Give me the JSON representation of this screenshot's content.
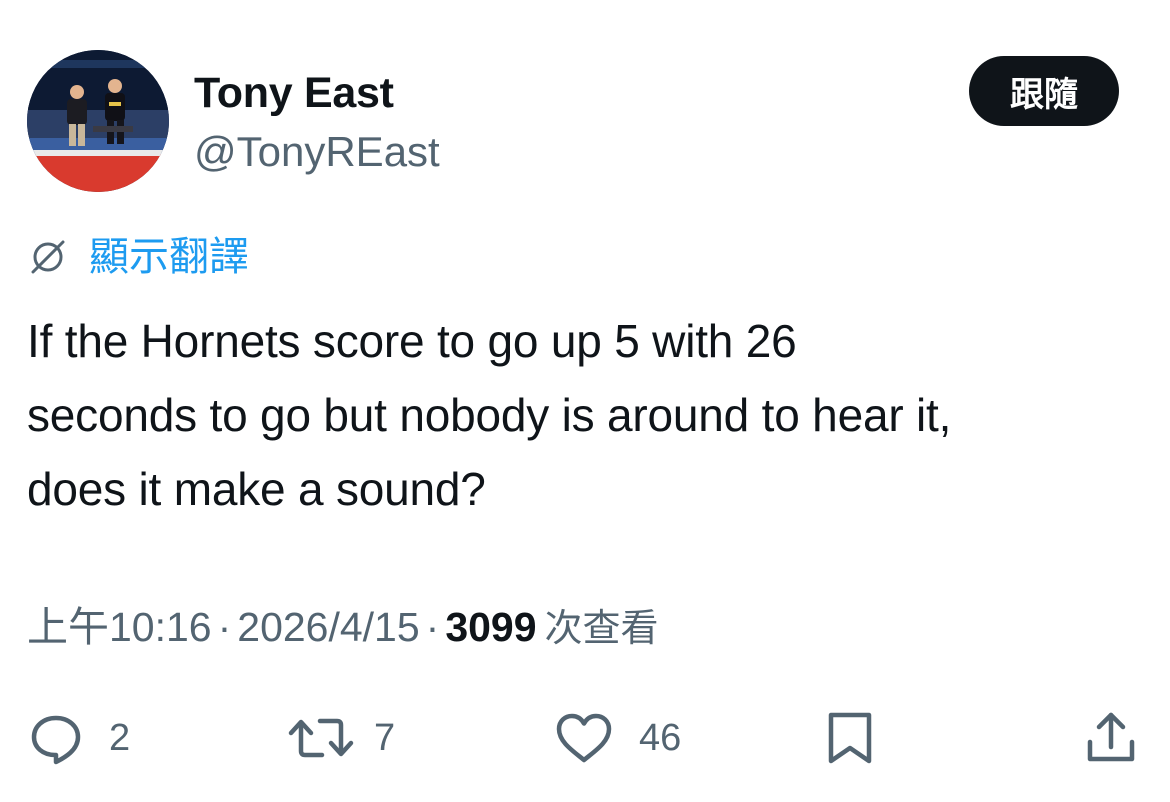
{
  "author": {
    "display_name": "Tony East",
    "handle": "@TonyREast"
  },
  "follow_button": {
    "label": "跟隨"
  },
  "translate": {
    "label": "顯示翻譯"
  },
  "tweet": {
    "text_lines": [
      "If the Hornets score to go up 5 with 26",
      "seconds to go but nobody is around to hear it,",
      "does it make a sound?"
    ]
  },
  "meta": {
    "time": "上午10:16",
    "separator": "·",
    "date": "2026/4/15",
    "views_count": "3099",
    "views_label": "次查看"
  },
  "actions": {
    "reply": {
      "icon": "reply-icon",
      "count": "2"
    },
    "retweet": {
      "icon": "retweet-icon",
      "count": "7"
    },
    "like": {
      "icon": "heart-icon",
      "count": "46"
    },
    "bookmark": {
      "icon": "bookmark-icon"
    },
    "share": {
      "icon": "share-icon"
    }
  },
  "colors": {
    "text": "#0f1419",
    "secondary": "#536471",
    "link": "#1d9bf0",
    "button_bg": "#0f1419"
  }
}
